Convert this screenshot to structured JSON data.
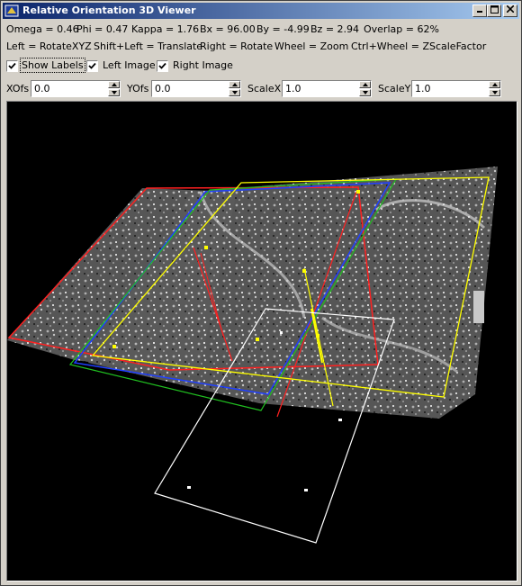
{
  "window": {
    "title": "Relative Orientation 3D Viewer",
    "buttons": {
      "minimize": "_",
      "maximize": "□",
      "close": "×"
    }
  },
  "status": {
    "omega": "Omega = 0.46",
    "phi": "Phi = 0.47",
    "kappa": "Kappa = 1.76",
    "bx": "Bx = 96.00",
    "by": "By = -4.99",
    "bz": "Bz = 2.94",
    "overlap": "Overlap = 62%"
  },
  "help": {
    "left": "Left = RotateXYZ",
    "shift_left": "Shift+Left = Translate",
    "right": "Right = Rotate",
    "wheel": "Wheel = Zoom",
    "ctrl_wheel": "Ctrl+Wheel = ZScaleFactor"
  },
  "checkboxes": {
    "show_labels": {
      "label": "Show Labels",
      "checked": true
    },
    "left_image": {
      "label": "Left Image",
      "checked": true
    },
    "right_image": {
      "label": "Right Image",
      "checked": true
    }
  },
  "fields": {
    "xofs": {
      "label": "XOfs",
      "value": "0.0"
    },
    "yofs": {
      "label": "YOfs",
      "value": "0.0"
    },
    "scalex": {
      "label": "ScaleX",
      "value": "1.0"
    },
    "scaley": {
      "label": "ScaleY",
      "value": "1.0"
    }
  },
  "colors": {
    "left_camera": "#ff2020",
    "right_camera": "#ffff00",
    "left_frame_blue": "#2040ff",
    "left_frame_green": "#20c020",
    "projection_frame": "#ffffff",
    "background": "#000000"
  }
}
